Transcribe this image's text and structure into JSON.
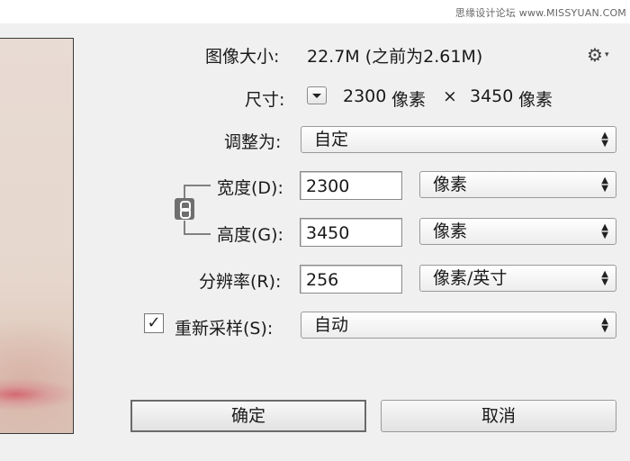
{
  "watermark": "思缘设计论坛 www.MISSYUAN.COM",
  "image_size": {
    "label": "图像大小:",
    "value": "22.7M (之前为2.61M)"
  },
  "dimensions": {
    "label": "尺寸:",
    "width": "2300",
    "width_unit": "像素",
    "times": "×",
    "height": "3450",
    "height_unit": "像素"
  },
  "fit_to": {
    "label": "调整为:",
    "value": "自定"
  },
  "width": {
    "label": "宽度(D):",
    "value": "2300",
    "unit": "像素"
  },
  "height": {
    "label": "高度(G):",
    "value": "3450",
    "unit": "像素"
  },
  "resolution": {
    "label": "分辨率(R):",
    "value": "256",
    "unit": "像素/英寸"
  },
  "resample": {
    "label": "重新采样(S):",
    "checked": true,
    "check_glyph": "✓",
    "value": "自动"
  },
  "buttons": {
    "ok": "确定",
    "cancel": "取消"
  },
  "icons": {
    "settings": "gear-icon",
    "constrain": "link-icon"
  }
}
